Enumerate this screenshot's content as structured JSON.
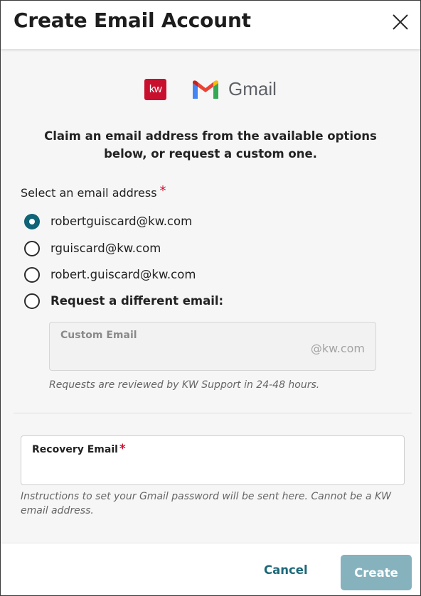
{
  "dialog": {
    "title": "Create Email Account"
  },
  "logos": {
    "kw_text": "kw",
    "gmail_text": "Gmail"
  },
  "intro_text": "Claim an email address from the available options below, or request a custom one.",
  "select": {
    "label": "Select an email address",
    "required_mark": "*",
    "selected_index": 0,
    "options": [
      {
        "label": "robertguiscard@kw.com",
        "checked": true
      },
      {
        "label": "rguiscard@kw.com",
        "checked": false
      },
      {
        "label": "robert.guiscard@kw.com",
        "checked": false
      },
      {
        "label": "Request a different email:",
        "checked": false
      }
    ]
  },
  "custom_email": {
    "label": "Custom Email",
    "suffix": "@kw.com",
    "helper": "Requests are reviewed by KW Support in 24-48 hours."
  },
  "recovery_email": {
    "label": "Recovery Email",
    "required_mark": "*",
    "value": "",
    "helper": "Instructions to set your Gmail password will be sent here. Cannot be a KW email address."
  },
  "footer": {
    "cancel_label": "Cancel",
    "create_label": "Create"
  },
  "colors": {
    "accent": "#0f6477",
    "required": "#c8102e",
    "create_disabled": "#86b2bd",
    "kw_red": "#c8102e"
  },
  "icons": [
    "close-icon",
    "kw-logo",
    "gmail-m-icon"
  ]
}
